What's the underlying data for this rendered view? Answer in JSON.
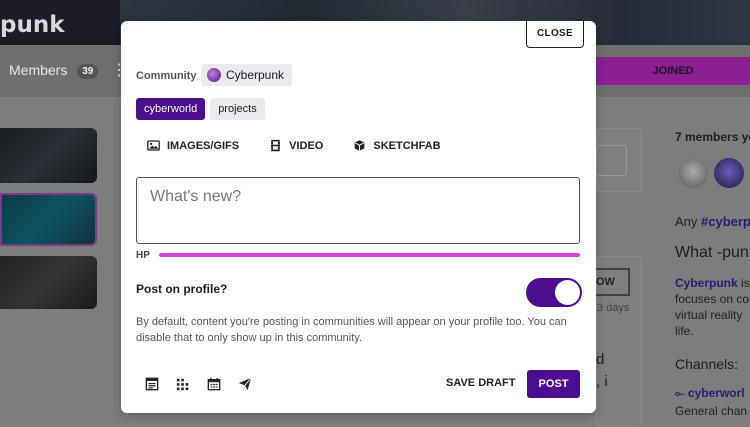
{
  "background": {
    "title": "punk",
    "nav": {
      "members_label": "Members",
      "members_count": "39",
      "more_glyph": "⋮",
      "joined_label": "JOINED"
    },
    "feed": {
      "follow_fragment": "OW",
      "time_fragment": "3 days",
      "line_fragment_1": "d",
      "line_fragment_2": ", i"
    },
    "sidebar": {
      "members_text": "7 members yo",
      "any_prefix": "Any ",
      "any_tag": "#cyberpunk",
      "what_text": "What -pun",
      "para_bold": "Cyberpunk",
      "para_rest_1": " is",
      "para_line_2": "focuses on co",
      "para_line_3": "virtual reality",
      "para_line_4": "life.",
      "channels_heading": "Channels:",
      "channel_name": "⟜ cyberworl",
      "channel_desc": "General chan"
    }
  },
  "modal": {
    "close_label": "CLOSE",
    "community_label": "Community",
    "community_name": "Cyberpunk",
    "tags": [
      {
        "label": "cyberworld",
        "active": true
      },
      {
        "label": "projects",
        "active": false
      }
    ],
    "media_buttons": [
      {
        "label": "IMAGES/GIFS",
        "icon": "image-icon"
      },
      {
        "label": "VIDEO",
        "icon": "film-icon"
      },
      {
        "label": "SKETCHFAB",
        "icon": "cube-icon"
      }
    ],
    "compose_placeholder": "What's new?",
    "hp_label": "HP",
    "hp_value_percent": 100,
    "post_on_profile_label": "Post on profile?",
    "post_on_profile_on": true,
    "helper_text": "By default, content you're posting in communities will appear on your profile too. You can disable that to only show up in this community.",
    "bottom_icons": [
      "article-icon",
      "poll-icon",
      "calendar-icon",
      "send-icon"
    ],
    "save_draft_label": "SAVE DRAFT",
    "post_label": "POST",
    "colors": {
      "accent": "#4a0e8f",
      "hp_bar": "#e040e0",
      "joined_bg": "#8b1f93"
    }
  }
}
